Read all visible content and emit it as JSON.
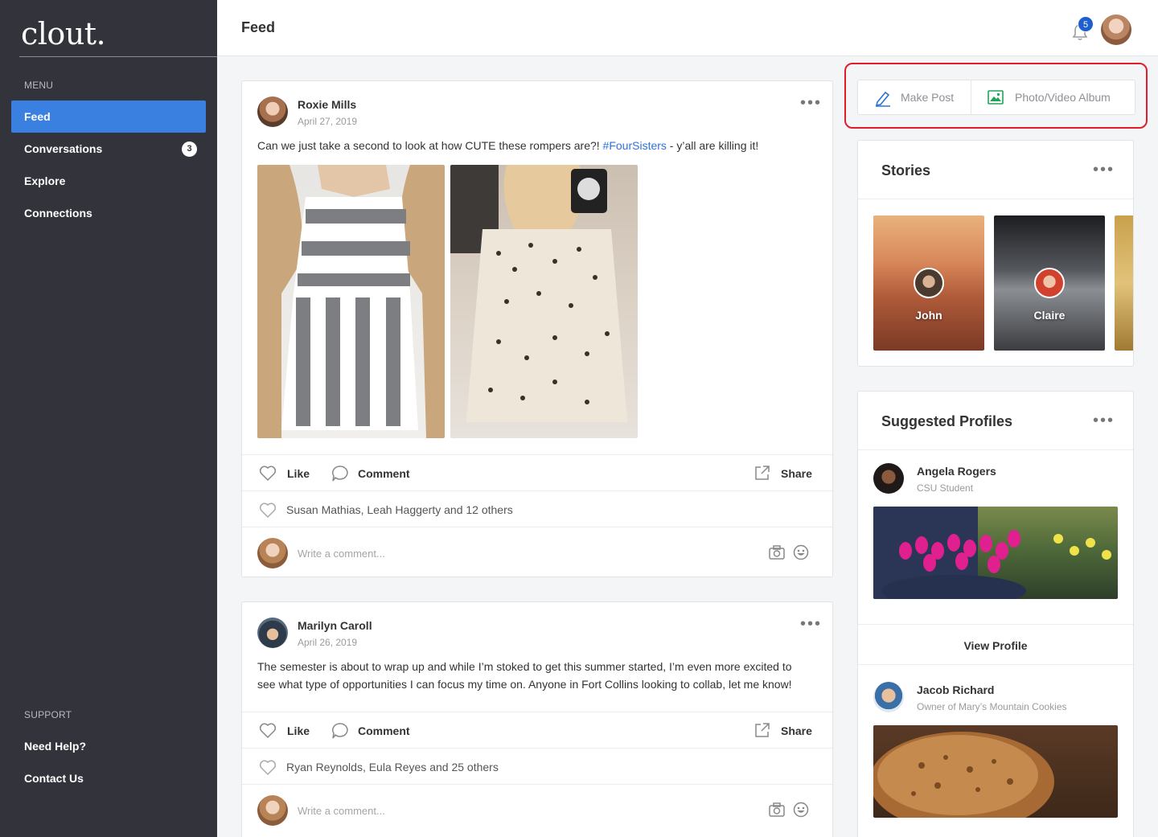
{
  "app": {
    "logo": "clout."
  },
  "sidebar": {
    "menu_label": "MENU",
    "items": [
      {
        "label": "Feed",
        "active": true
      },
      {
        "label": "Conversations",
        "badge": "3"
      },
      {
        "label": "Explore"
      },
      {
        "label": "Connections"
      }
    ],
    "support_label": "SUPPORT",
    "support_items": [
      {
        "label": "Need Help?"
      },
      {
        "label": "Contact Us"
      }
    ]
  },
  "header": {
    "title": "Feed",
    "notification_count": "5"
  },
  "posts": [
    {
      "author": "Roxie Mills",
      "date": "April 27, 2019",
      "text_before": "Can we just take a second to look at how CUTE these rompers are?! ",
      "hashtag": "#FourSisters",
      "text_after": " - y’all are killing it!",
      "like_label": "Like",
      "comment_label": "Comment",
      "share_label": "Share",
      "likes_text": "Susan Mathias, Leah Haggerty and 12 others",
      "comment_placeholder": "Write a comment..."
    },
    {
      "author": "Marilyn Caroll",
      "date": "April 26, 2019",
      "text": "The semester is about to wrap up and while I’m stoked to get this summer started, I’m even more excited to see what type of opportunities I can focus my time on. Anyone in Fort Collins looking to collab, let me know!",
      "like_label": "Like",
      "comment_label": "Comment",
      "share_label": "Share",
      "likes_text": "Ryan Reynolds, Eula Reyes and 25 others",
      "comment_placeholder": "Write a comment..."
    }
  ],
  "make_post": {
    "make_post_label": "Make Post",
    "album_label": "Photo/Video Album"
  },
  "stories": {
    "title": "Stories",
    "items": [
      {
        "name": "John"
      },
      {
        "name": "Claire"
      }
    ]
  },
  "suggested": {
    "title": "Suggested Profiles",
    "profiles": [
      {
        "name": "Angela Rogers",
        "subtitle": "CSU Student",
        "button": "View Profile"
      },
      {
        "name": "Jacob Richard",
        "subtitle": "Owner of Mary’s Mountain Cookies"
      }
    ]
  },
  "colors": {
    "sidebar_bg": "#32333b",
    "accent": "#3a80e0",
    "highlight_border": "#e11d2b",
    "notification_badge": "#1e5fd0"
  }
}
